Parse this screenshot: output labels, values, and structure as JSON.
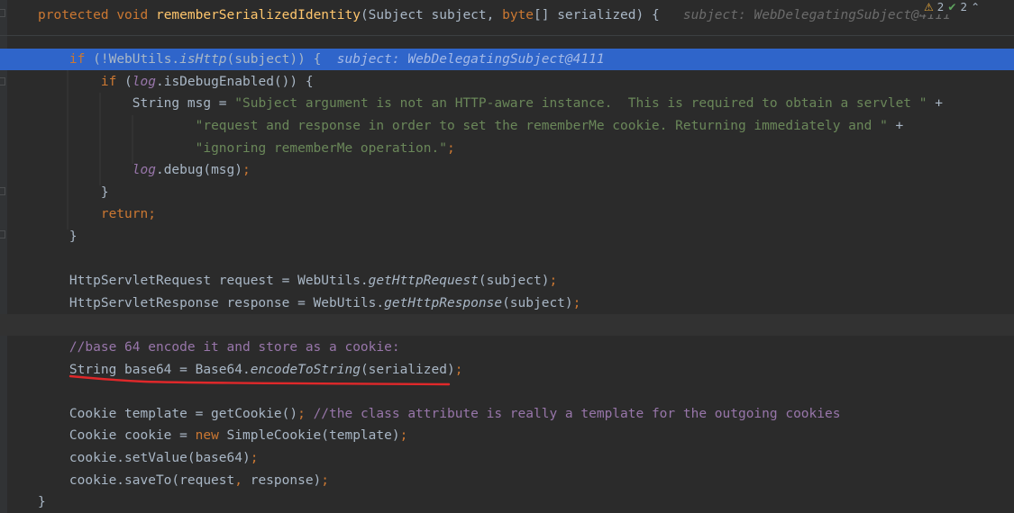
{
  "inspection": {
    "warnings_icon": "warning-triangle-icon",
    "warnings_count": "2",
    "passed_icon": "check-icon",
    "passed_count": "2",
    "nav_icon": "chevron-up-icon"
  },
  "colors": {
    "background": "#2b2b2b",
    "execution_line": "#2f65ca",
    "keyword": "#cc7832",
    "string": "#6a8759",
    "comment": "#808080",
    "method_decl": "#ffc66d",
    "field": "#9876aa",
    "underline_annotation": "#e0282a"
  },
  "code": {
    "lines": [
      {
        "type": "normal",
        "indent": "",
        "tokens": [
          {
            "t": "protected ",
            "c": "kw"
          },
          {
            "t": "void ",
            "c": "kw"
          },
          {
            "t": "rememberSerializedIdentity",
            "c": "fn"
          },
          {
            "t": "(Subject subject, "
          },
          {
            "t": "byte",
            "c": "kw"
          },
          {
            "t": "[] serialized) {"
          },
          {
            "t": "   subject: WebDelegatingSubject@4111",
            "c": "ghost"
          }
        ]
      },
      {
        "type": "blank",
        "tokens": []
      },
      {
        "type": "exec",
        "indent": "    ",
        "tokens": [
          {
            "t": "if ",
            "c": "kw"
          },
          {
            "t": "(!WebUtils."
          },
          {
            "t": "isHttp",
            "c": "it"
          },
          {
            "t": "(subject)) {"
          },
          {
            "t": "  subject: WebDelegatingSubject@4111",
            "c": "ghost"
          }
        ]
      },
      {
        "type": "normal",
        "indent": "        ",
        "tokens": [
          {
            "t": "if ",
            "c": "kw"
          },
          {
            "t": "("
          },
          {
            "t": "log",
            "c": "fld"
          },
          {
            "t": ".isDebugEnabled()) {"
          }
        ]
      },
      {
        "type": "normal",
        "indent": "            ",
        "tokens": [
          {
            "t": "String msg = "
          },
          {
            "t": "\"Subject argument is not an HTTP-aware instance.  This is required to obtain a servlet \"",
            "c": "str"
          },
          {
            "t": " +"
          }
        ]
      },
      {
        "type": "normal",
        "indent": "                    ",
        "tokens": [
          {
            "t": "\"request and response in order to set the rememberMe cookie. Returning immediately and \"",
            "c": "str"
          },
          {
            "t": " +"
          }
        ]
      },
      {
        "type": "normal",
        "indent": "                    ",
        "tokens": [
          {
            "t": "\"ignoring rememberMe operation.\"",
            "c": "str"
          },
          {
            "t": ";",
            "c": "kw"
          }
        ]
      },
      {
        "type": "normal",
        "indent": "            ",
        "tokens": [
          {
            "t": "log",
            "c": "fld"
          },
          {
            "t": ".debug(msg)"
          },
          {
            "t": ";",
            "c": "kw"
          }
        ]
      },
      {
        "type": "normal",
        "indent": "        ",
        "tokens": [
          {
            "t": "}"
          }
        ]
      },
      {
        "type": "normal",
        "indent": "        ",
        "tokens": [
          {
            "t": "return;",
            "c": "kw"
          }
        ]
      },
      {
        "type": "normal",
        "indent": "    ",
        "tokens": [
          {
            "t": "}"
          }
        ]
      },
      {
        "type": "blank",
        "tokens": []
      },
      {
        "type": "normal",
        "indent": "    ",
        "tokens": [
          {
            "t": "HttpServletRequest request = WebUtils."
          },
          {
            "t": "getHttpRequest",
            "c": "it"
          },
          {
            "t": "(subject)"
          },
          {
            "t": ";",
            "c": "kw"
          }
        ]
      },
      {
        "type": "normal",
        "indent": "    ",
        "tokens": [
          {
            "t": "HttpServletResponse response = WebUtils."
          },
          {
            "t": "getHttpResponse",
            "c": "it"
          },
          {
            "t": "(subject)"
          },
          {
            "t": ";",
            "c": "kw"
          }
        ]
      },
      {
        "type": "caret",
        "tokens": []
      },
      {
        "type": "normal",
        "indent": "    ",
        "tokens": [
          {
            "t": "//base 64 encode it and store as a cookie:",
            "c": "cmp"
          }
        ]
      },
      {
        "type": "normal",
        "indent": "    ",
        "tokens": [
          {
            "t": "String base64 = Base64."
          },
          {
            "t": "encodeToString",
            "c": "it"
          },
          {
            "t": "(serialized)"
          },
          {
            "t": ";",
            "c": "kw"
          }
        ]
      },
      {
        "type": "blank",
        "tokens": []
      },
      {
        "type": "normal",
        "indent": "    ",
        "tokens": [
          {
            "t": "Cookie template = getCookie()"
          },
          {
            "t": "; ",
            "c": "kw"
          },
          {
            "t": "//the class attribute is really a template for the outgoing cookies",
            "c": "cmp"
          }
        ]
      },
      {
        "type": "normal",
        "indent": "    ",
        "tokens": [
          {
            "t": "Cookie cookie = "
          },
          {
            "t": "new ",
            "c": "kw"
          },
          {
            "t": "SimpleCookie(template)"
          },
          {
            "t": ";",
            "c": "kw"
          }
        ]
      },
      {
        "type": "normal",
        "indent": "    ",
        "tokens": [
          {
            "t": "cookie.setValue(base64)"
          },
          {
            "t": ";",
            "c": "kw"
          }
        ]
      },
      {
        "type": "normal",
        "indent": "    ",
        "tokens": [
          {
            "t": "cookie.saveTo(request"
          },
          {
            "t": ", ",
            "c": "kw"
          },
          {
            "t": "response)"
          },
          {
            "t": ";",
            "c": "kw"
          }
        ]
      },
      {
        "type": "normal",
        "indent": "",
        "tokens": [
          {
            "t": "}"
          }
        ]
      }
    ]
  }
}
